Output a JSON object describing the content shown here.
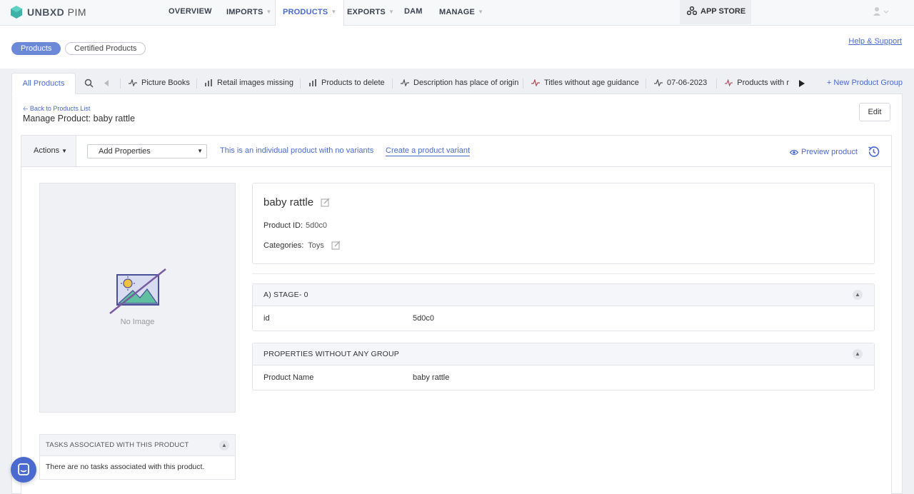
{
  "brand": {
    "name": "UNBXD",
    "suffix": "PIM",
    "color": "#3cb3a8"
  },
  "nav": {
    "overview": "OVERVIEW",
    "imports": "IMPORTS",
    "products": "PRODUCTS",
    "exports": "EXPORTS",
    "dam": "DAM",
    "manage": "MANAGE",
    "appstore": "APP STORE"
  },
  "subnav": {
    "products": "Products",
    "certified": "Certified Products",
    "help": "Help & Support"
  },
  "groups": {
    "all": "All Products",
    "items": [
      "Picture Books",
      "Retail images missing",
      "Products to delete",
      "Description has place of origin",
      "Titles without age guidance",
      "07-06-2023",
      "Products with r"
    ],
    "new": "+ New Product Group"
  },
  "page": {
    "back": "Back to Products List",
    "title": "Manage Product: baby rattle",
    "edit": "Edit"
  },
  "toolbar": {
    "actions": "Actions",
    "add_properties": "Add Properties",
    "no_variants": "This is an individual product with no variants",
    "create_variant": "Create a product variant",
    "preview": "Preview product"
  },
  "image": {
    "no_image": "No Image"
  },
  "tasks": {
    "header": "TASKS ASSOCIATED WITH THIS PRODUCT",
    "empty": "There are no tasks associated with this product."
  },
  "product": {
    "name": "baby rattle",
    "id_label": "Product ID:",
    "id_value": "5d0c0",
    "categories_label": "Categories:",
    "categories_value": "Toys"
  },
  "sections": [
    {
      "title": "A) STAGE- 0",
      "rows": [
        {
          "key": "id",
          "value": "5d0c0"
        }
      ]
    },
    {
      "title": "PROPERTIES WITHOUT ANY GROUP",
      "rows": [
        {
          "key": "Product Name",
          "value": "baby rattle"
        }
      ]
    }
  ],
  "colors": {
    "accent": "#4a6ad0",
    "pill_active": "#6c89d8"
  }
}
